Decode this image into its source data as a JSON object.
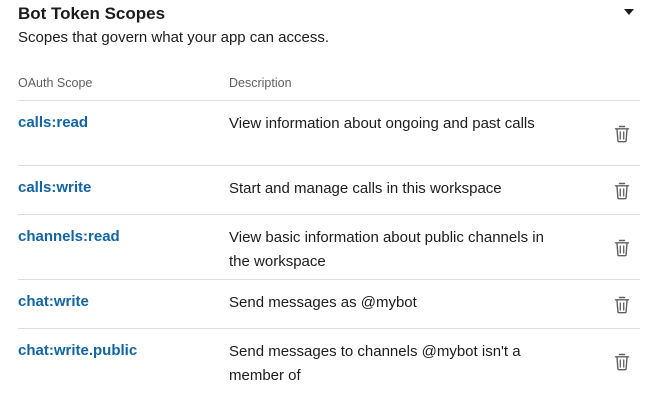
{
  "section": {
    "title": "Bot Token Scopes",
    "subtitle": "Scopes that govern what your app can access."
  },
  "columns": {
    "scope": "OAuth Scope",
    "description": "Description"
  },
  "scopes": [
    {
      "name": "calls:read",
      "description": "View information about ongoing and past calls"
    },
    {
      "name": "calls:write",
      "description": "Start and manage calls in this workspace"
    },
    {
      "name": "channels:read",
      "description": "View basic information about public channels in the workspace"
    },
    {
      "name": "chat:write",
      "description": "Send messages as @mybot"
    },
    {
      "name": "chat:write.public",
      "description": "Send messages to channels @mybot isn't a member of"
    }
  ],
  "icons": {
    "collapse": "caret-down-icon",
    "remove": "trash-icon"
  },
  "colors": {
    "link": "#1264a3",
    "text": "#1d1c1d",
    "muted": "#616061",
    "divider": "#dddddd"
  }
}
